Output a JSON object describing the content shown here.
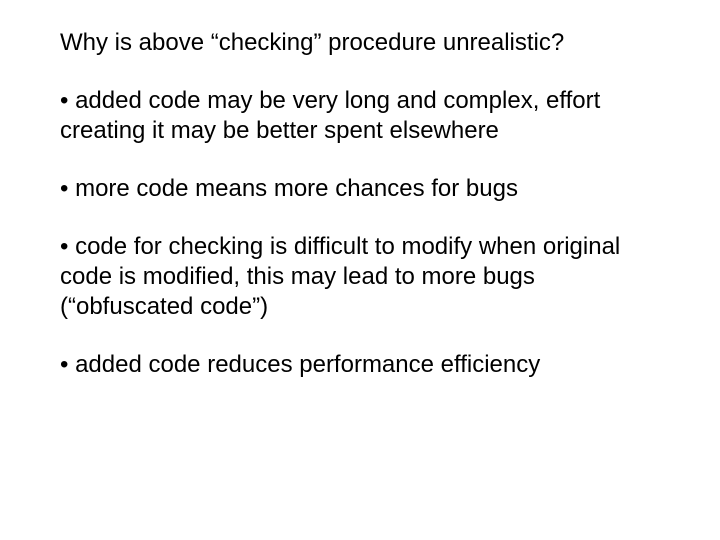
{
  "title": "Why is above “checking” procedure unrealistic?",
  "bullets": [
    "added code may be very long and complex, effort creating it may be better spent elsewhere",
    "more code means more chances for bugs",
    "code for checking is difficult to modify when original code is modified, this may lead to more bugs (“obfuscated code”)",
    "added code reduces performance efficiency"
  ]
}
